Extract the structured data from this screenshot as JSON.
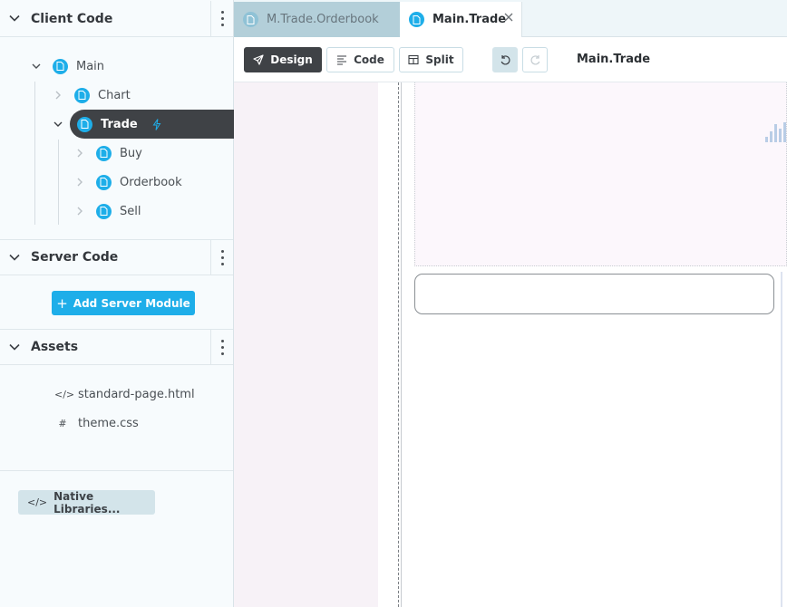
{
  "sidebar": {
    "client_code": {
      "title": "Client Code",
      "tree": [
        {
          "label": "Main"
        },
        {
          "label": "Chart"
        },
        {
          "label": "Trade"
        },
        {
          "label": "Buy"
        },
        {
          "label": "Orderbook"
        },
        {
          "label": "Sell"
        }
      ]
    },
    "server_code": {
      "title": "Server Code",
      "add_button": "Add Server Module"
    },
    "assets": {
      "title": "Assets",
      "items": [
        {
          "icon": "code-icon",
          "label": "standard-page.html"
        },
        {
          "icon": "hash-icon",
          "label": "theme.css"
        }
      ]
    },
    "native_libraries": "Native Libraries..."
  },
  "tabs": [
    {
      "label": "M.Trade.Orderbook",
      "active": false
    },
    {
      "label": "Main.Trade",
      "active": true
    }
  ],
  "toolbar": {
    "design": "Design",
    "code": "Code",
    "split": "Split",
    "title": "Main.Trade"
  },
  "colors": {
    "accent": "#1eaee9",
    "dark": "#3f4246",
    "sidebar_bg": "#f7fbfd"
  }
}
